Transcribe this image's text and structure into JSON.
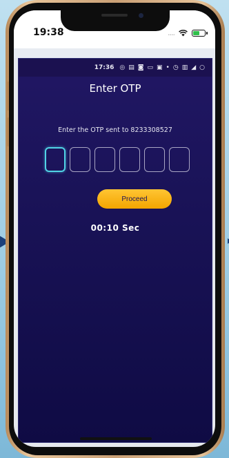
{
  "ios_status": {
    "time": "19:38"
  },
  "android_status": {
    "time": "17:36",
    "icons": [
      "whatsapp-icon",
      "message-icon",
      "instagram-icon",
      "sms-icon",
      "app-icon",
      "dot-icon",
      "alarm-icon",
      "network-icon",
      "signal-icon",
      "loading-icon"
    ]
  },
  "screen": {
    "title": "Enter OTP",
    "instruction": "Enter the OTP sent to 8233308527",
    "otp_boxes": [
      "",
      "",
      "",
      "",
      "",
      ""
    ],
    "proceed_label": "Proceed",
    "timer": "00:10  Sec"
  },
  "colors": {
    "background": "#1a1358",
    "accent": "#f5b400",
    "active_box": "#51d4e6"
  }
}
